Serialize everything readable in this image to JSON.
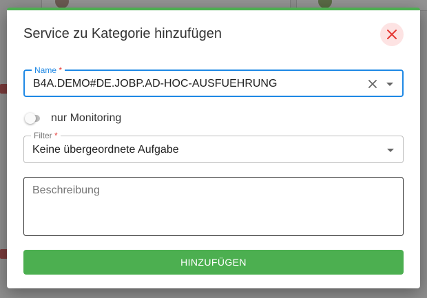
{
  "dialog": {
    "title": "Service zu Kategorie hinzufügen",
    "close_icon": "close-icon",
    "accent_color": "#4caf50",
    "name_field": {
      "label": "Name",
      "required_marker": "*",
      "value": "B4A.DEMO#DE.JOBP.AD-HOC-AUSFUEHRUNG"
    },
    "monitoring_toggle": {
      "label": "nur Monitoring",
      "checked": false
    },
    "filter_field": {
      "label": "Filter",
      "required_marker": "*",
      "value": "Keine übergeordnete Aufgabe"
    },
    "description_field": {
      "placeholder": "Beschreibung",
      "value": ""
    },
    "submit_label": "HINZUFÜGEN"
  }
}
